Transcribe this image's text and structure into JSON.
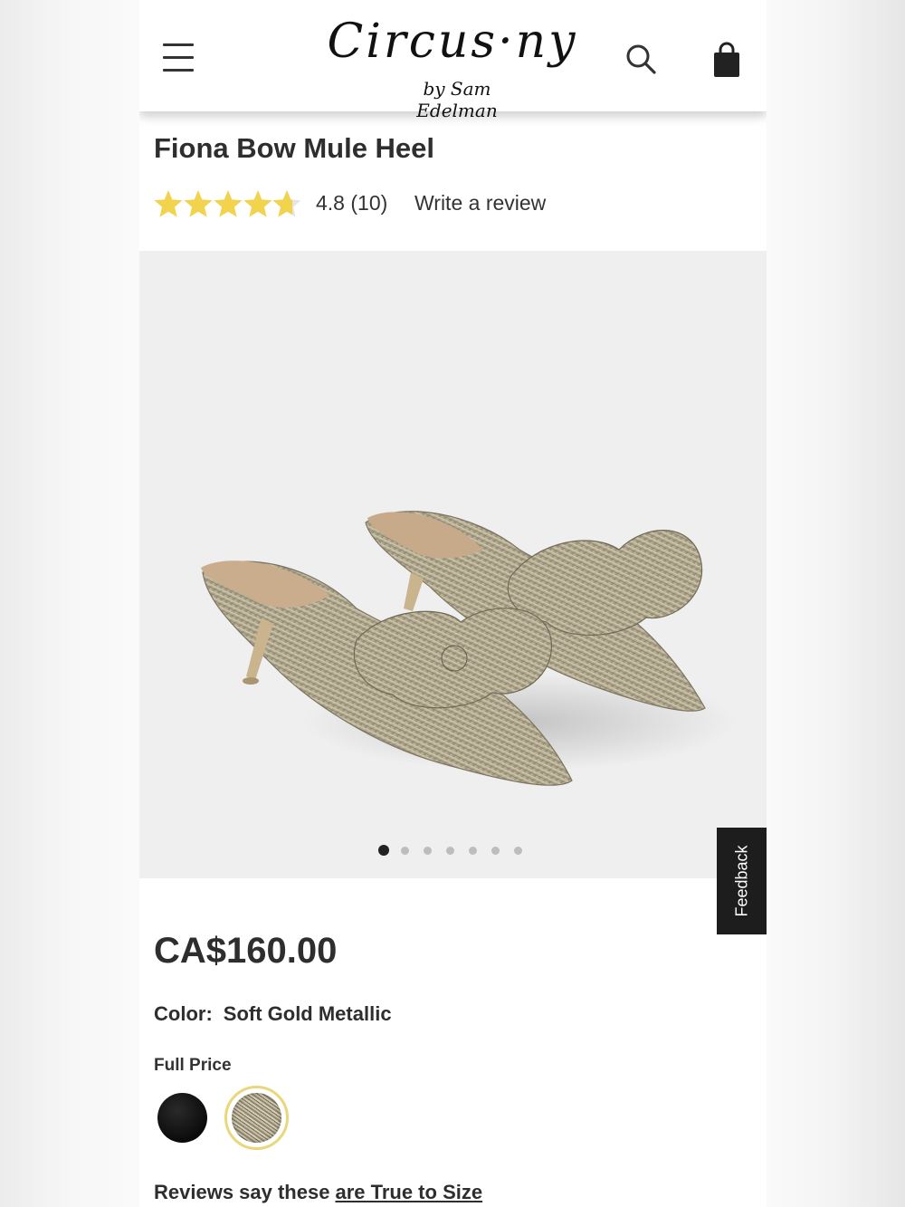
{
  "header": {
    "logo_main": "Circus·ny",
    "logo_sub": "by Sam Edelman"
  },
  "product": {
    "title": "Fiona Bow Mule Heel",
    "rating": 4.8,
    "rating_text": "4.8 (10)",
    "write_review": "Write a review",
    "price": "CA$160.00",
    "color_label": "Color:",
    "color_value": "Soft Gold Metallic",
    "price_type": "Full Price",
    "swatches": [
      {
        "name": "black",
        "color": "#111111",
        "selected": false
      },
      {
        "name": "soft-gold-metallic",
        "color": "#b9ae90",
        "selected": true
      }
    ],
    "reviews_prefix": "Reviews say these",
    "reviews_link": "are True to Size"
  },
  "gallery": {
    "slide_count": 7,
    "active_index": 0
  },
  "feedback_tab": "Feedback",
  "colors": {
    "star": "#f2d34d",
    "swatch_ring": "#e9d77d",
    "feedback_bg": "#1d1d1d"
  }
}
